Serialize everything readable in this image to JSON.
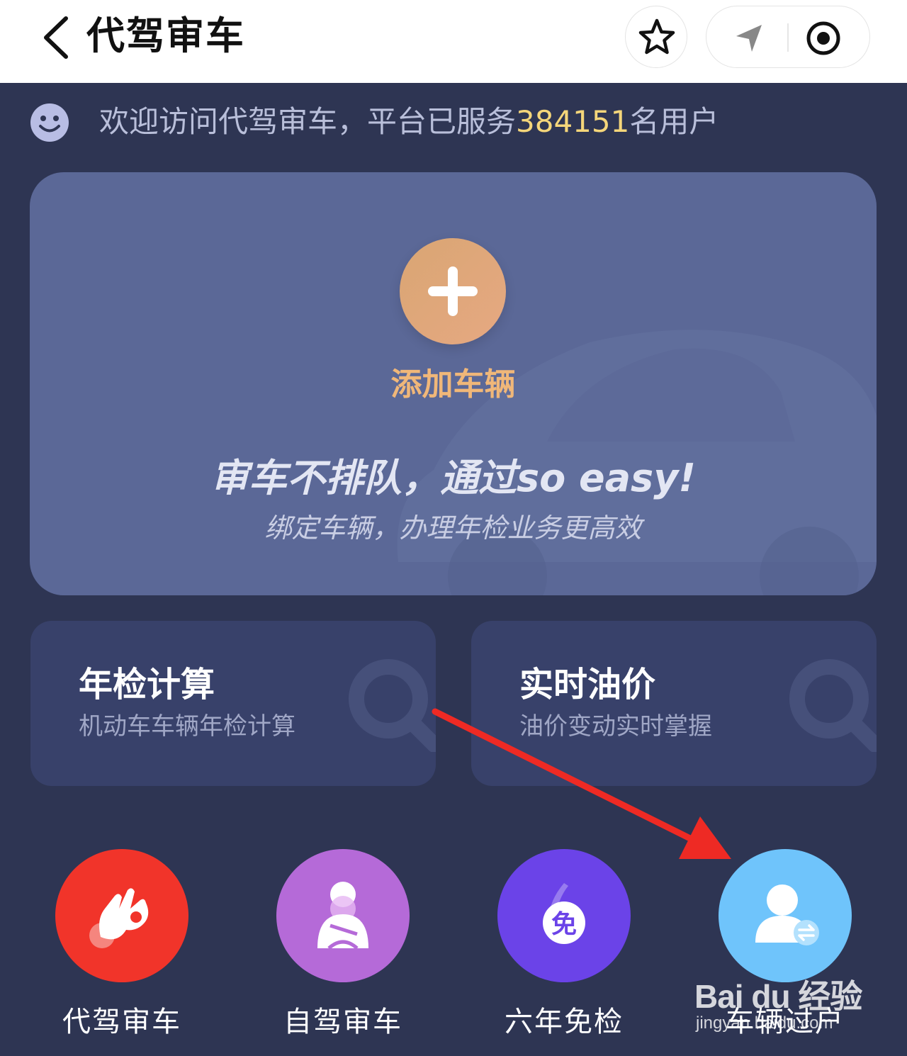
{
  "header": {
    "title": "代驾审车",
    "back_icon": "chevron-left-icon",
    "star_icon": "star-icon",
    "location_icon": "location-arrow-icon",
    "record_icon": "record-circle-icon"
  },
  "welcome": {
    "prefix": "欢迎访问代驾审车，平台已服务",
    "count": "384151",
    "suffix": "名用户",
    "icon": "smile-icon"
  },
  "vehicle_card": {
    "add_label": "添加车辆",
    "slogan": "审车不排队，通过so easy!",
    "subtitle": "绑定车辆，办理年检业务更高效"
  },
  "tools": [
    {
      "title": "年检计算",
      "subtitle": "机动车车辆年检计算"
    },
    {
      "title": "实时油价",
      "subtitle": "油价变动实时掌握"
    }
  ],
  "services": [
    {
      "label": "代驾审车",
      "icon": "ok-hand-icon",
      "color": "#f1342a"
    },
    {
      "label": "自驾审车",
      "icon": "driver-icon",
      "color": "#b56ad8"
    },
    {
      "label": "六年免检",
      "icon": "six-year-exempt-icon",
      "color": "#6b43e8"
    },
    {
      "label": "车辆过户",
      "icon": "transfer-user-icon",
      "color": "#6fc4fb"
    }
  ],
  "watermark": {
    "logo": "Bai du 经验",
    "url": "jingyan.baidu.com"
  },
  "colors": {
    "background": "#2e3553",
    "card": "#5b6897",
    "tool_card": "#38416a",
    "accent_orange": "#f0b779",
    "count_highlight": "#f5d67a",
    "annotation_arrow": "#ee2a24"
  }
}
